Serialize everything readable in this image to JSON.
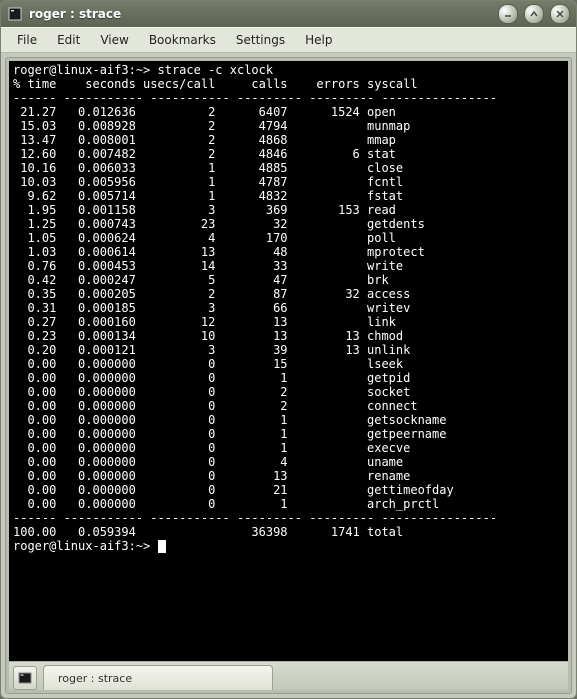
{
  "window": {
    "title": "roger : strace"
  },
  "menu": {
    "items": [
      "File",
      "Edit",
      "View",
      "Bookmarks",
      "Settings",
      "Help"
    ]
  },
  "terminal": {
    "prompt": "roger@linux-aif3:~>",
    "command": "strace -c xclock",
    "headers": [
      "% time",
      "seconds",
      "usecs/call",
      "calls",
      "errors",
      "syscall"
    ],
    "rows": [
      {
        "t": "21.27",
        "s": "0.012636",
        "u": "2",
        "c": "6407",
        "e": "1524",
        "name": "open"
      },
      {
        "t": "15.03",
        "s": "0.008928",
        "u": "2",
        "c": "4794",
        "e": "",
        "name": "munmap"
      },
      {
        "t": "13.47",
        "s": "0.008001",
        "u": "2",
        "c": "4868",
        "e": "",
        "name": "mmap"
      },
      {
        "t": "12.60",
        "s": "0.007482",
        "u": "2",
        "c": "4846",
        "e": "6",
        "name": "stat"
      },
      {
        "t": "10.16",
        "s": "0.006033",
        "u": "1",
        "c": "4885",
        "e": "",
        "name": "close"
      },
      {
        "t": "10.03",
        "s": "0.005956",
        "u": "1",
        "c": "4787",
        "e": "",
        "name": "fcntl"
      },
      {
        "t": "9.62",
        "s": "0.005714",
        "u": "1",
        "c": "4832",
        "e": "",
        "name": "fstat"
      },
      {
        "t": "1.95",
        "s": "0.001158",
        "u": "3",
        "c": "369",
        "e": "153",
        "name": "read"
      },
      {
        "t": "1.25",
        "s": "0.000743",
        "u": "23",
        "c": "32",
        "e": "",
        "name": "getdents"
      },
      {
        "t": "1.05",
        "s": "0.000624",
        "u": "4",
        "c": "170",
        "e": "",
        "name": "poll"
      },
      {
        "t": "1.03",
        "s": "0.000614",
        "u": "13",
        "c": "48",
        "e": "",
        "name": "mprotect"
      },
      {
        "t": "0.76",
        "s": "0.000453",
        "u": "14",
        "c": "33",
        "e": "",
        "name": "write"
      },
      {
        "t": "0.42",
        "s": "0.000247",
        "u": "5",
        "c": "47",
        "e": "",
        "name": "brk"
      },
      {
        "t": "0.35",
        "s": "0.000205",
        "u": "2",
        "c": "87",
        "e": "32",
        "name": "access"
      },
      {
        "t": "0.31",
        "s": "0.000185",
        "u": "3",
        "c": "66",
        "e": "",
        "name": "writev"
      },
      {
        "t": "0.27",
        "s": "0.000160",
        "u": "12",
        "c": "13",
        "e": "",
        "name": "link"
      },
      {
        "t": "0.23",
        "s": "0.000134",
        "u": "10",
        "c": "13",
        "e": "13",
        "name": "chmod"
      },
      {
        "t": "0.20",
        "s": "0.000121",
        "u": "3",
        "c": "39",
        "e": "13",
        "name": "unlink"
      },
      {
        "t": "0.00",
        "s": "0.000000",
        "u": "0",
        "c": "15",
        "e": "",
        "name": "lseek"
      },
      {
        "t": "0.00",
        "s": "0.000000",
        "u": "0",
        "c": "1",
        "e": "",
        "name": "getpid"
      },
      {
        "t": "0.00",
        "s": "0.000000",
        "u": "0",
        "c": "2",
        "e": "",
        "name": "socket"
      },
      {
        "t": "0.00",
        "s": "0.000000",
        "u": "0",
        "c": "2",
        "e": "",
        "name": "connect"
      },
      {
        "t": "0.00",
        "s": "0.000000",
        "u": "0",
        "c": "1",
        "e": "",
        "name": "getsockname"
      },
      {
        "t": "0.00",
        "s": "0.000000",
        "u": "0",
        "c": "1",
        "e": "",
        "name": "getpeername"
      },
      {
        "t": "0.00",
        "s": "0.000000",
        "u": "0",
        "c": "1",
        "e": "",
        "name": "execve"
      },
      {
        "t": "0.00",
        "s": "0.000000",
        "u": "0",
        "c": "4",
        "e": "",
        "name": "uname"
      },
      {
        "t": "0.00",
        "s": "0.000000",
        "u": "0",
        "c": "13",
        "e": "",
        "name": "rename"
      },
      {
        "t": "0.00",
        "s": "0.000000",
        "u": "0",
        "c": "21",
        "e": "",
        "name": "gettimeofday"
      },
      {
        "t": "0.00",
        "s": "0.000000",
        "u": "0",
        "c": "1",
        "e": "",
        "name": "arch_prctl"
      }
    ],
    "total": {
      "t": "100.00",
      "s": "0.059394",
      "u": "",
      "c": "36398",
      "e": "1741",
      "name": "total"
    }
  },
  "tab": {
    "label": "roger : strace"
  },
  "chart_data": {
    "type": "table",
    "title": "strace -c xclock summary",
    "columns": [
      "% time",
      "seconds",
      "usecs/call",
      "calls",
      "errors",
      "syscall"
    ],
    "rows": [
      [
        21.27,
        0.012636,
        2,
        6407,
        1524,
        "open"
      ],
      [
        15.03,
        0.008928,
        2,
        4794,
        null,
        "munmap"
      ],
      [
        13.47,
        0.008001,
        2,
        4868,
        null,
        "mmap"
      ],
      [
        12.6,
        0.007482,
        2,
        4846,
        6,
        "stat"
      ],
      [
        10.16,
        0.006033,
        1,
        4885,
        null,
        "close"
      ],
      [
        10.03,
        0.005956,
        1,
        4787,
        null,
        "fcntl"
      ],
      [
        9.62,
        0.005714,
        1,
        4832,
        null,
        "fstat"
      ],
      [
        1.95,
        0.001158,
        3,
        369,
        153,
        "read"
      ],
      [
        1.25,
        0.000743,
        23,
        32,
        null,
        "getdents"
      ],
      [
        1.05,
        0.000624,
        4,
        170,
        null,
        "poll"
      ],
      [
        1.03,
        0.000614,
        13,
        48,
        null,
        "mprotect"
      ],
      [
        0.76,
        0.000453,
        14,
        33,
        null,
        "write"
      ],
      [
        0.42,
        0.000247,
        5,
        47,
        null,
        "brk"
      ],
      [
        0.35,
        0.000205,
        2,
        87,
        32,
        "access"
      ],
      [
        0.31,
        0.000185,
        3,
        66,
        null,
        "writev"
      ],
      [
        0.27,
        0.00016,
        12,
        13,
        null,
        "link"
      ],
      [
        0.23,
        0.000134,
        10,
        13,
        13,
        "chmod"
      ],
      [
        0.2,
        0.000121,
        3,
        39,
        13,
        "unlink"
      ],
      [
        0.0,
        0.0,
        0,
        15,
        null,
        "lseek"
      ],
      [
        0.0,
        0.0,
        0,
        1,
        null,
        "getpid"
      ],
      [
        0.0,
        0.0,
        0,
        2,
        null,
        "socket"
      ],
      [
        0.0,
        0.0,
        0,
        2,
        null,
        "connect"
      ],
      [
        0.0,
        0.0,
        0,
        1,
        null,
        "getsockname"
      ],
      [
        0.0,
        0.0,
        0,
        1,
        null,
        "getpeername"
      ],
      [
        0.0,
        0.0,
        0,
        1,
        null,
        "execve"
      ],
      [
        0.0,
        0.0,
        0,
        4,
        null,
        "uname"
      ],
      [
        0.0,
        0.0,
        0,
        13,
        null,
        "rename"
      ],
      [
        0.0,
        0.0,
        0,
        21,
        null,
        "gettimeofday"
      ],
      [
        0.0,
        0.0,
        0,
        1,
        null,
        "arch_prctl"
      ]
    ],
    "total": [
      100.0,
      0.059394,
      null,
      36398,
      1741,
      "total"
    ]
  }
}
